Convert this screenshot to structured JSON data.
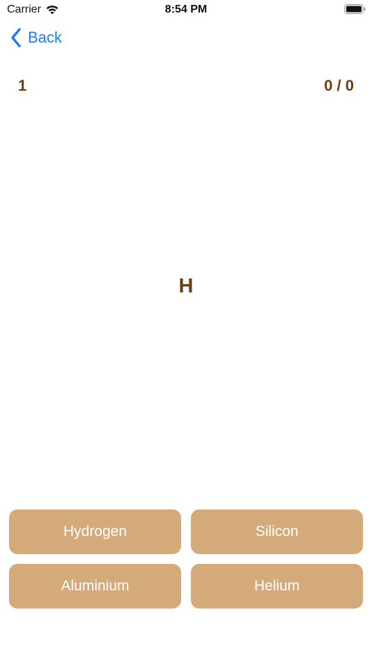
{
  "status_bar": {
    "carrier": "Carrier",
    "time": "8:54 PM"
  },
  "nav": {
    "back_label": "Back"
  },
  "quiz": {
    "question_number": "1",
    "score": "0 / 0",
    "symbol": "H",
    "answers": [
      "Hydrogen",
      "Silicon",
      "Aluminium",
      "Helium"
    ]
  },
  "colors": {
    "accent_blue": "#1a7cf0",
    "brown_text": "#6b3e10",
    "button_fill": "#d5aa7b"
  },
  "icons": {
    "wifi": "wifi-icon",
    "battery": "battery-icon",
    "back": "chevron-left-icon"
  }
}
